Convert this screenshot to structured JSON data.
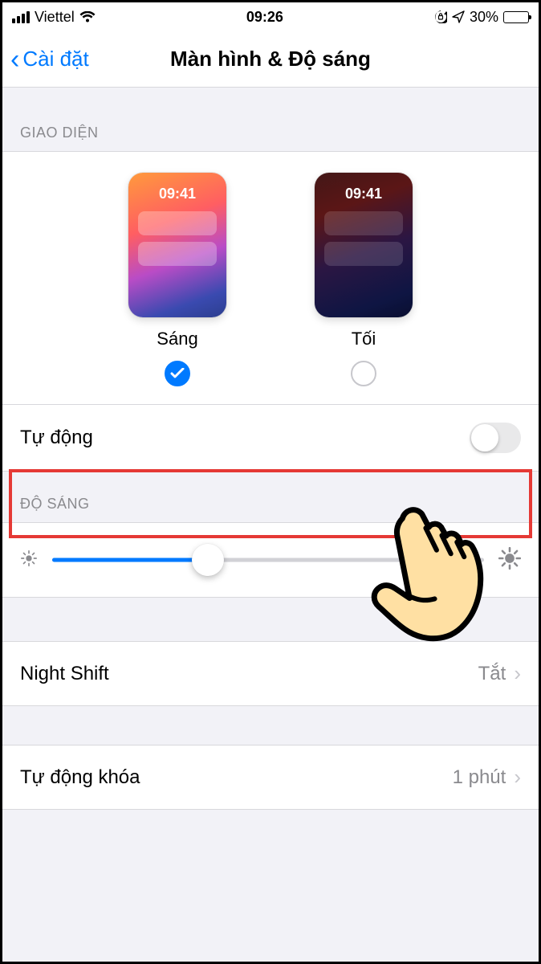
{
  "status": {
    "carrier": "Viettel",
    "time": "09:26",
    "battery_pct": "30%"
  },
  "nav": {
    "back_label": "Cài đặt",
    "title": "Màn hình & Độ sáng"
  },
  "appearance": {
    "header": "GIAO DIỆN",
    "preview_time": "09:41",
    "light_label": "Sáng",
    "dark_label": "Tối",
    "selected": "light"
  },
  "auto_row": {
    "label": "Tự động",
    "on": false
  },
  "brightness": {
    "header": "ĐỘ SÁNG",
    "value_pct": 36
  },
  "night_shift": {
    "label": "Night Shift",
    "value": "Tắt"
  },
  "auto_lock": {
    "label": "Tự động khóa",
    "value": "1 phút"
  },
  "colors": {
    "accent": "#007aff",
    "highlight": "#e53935"
  }
}
